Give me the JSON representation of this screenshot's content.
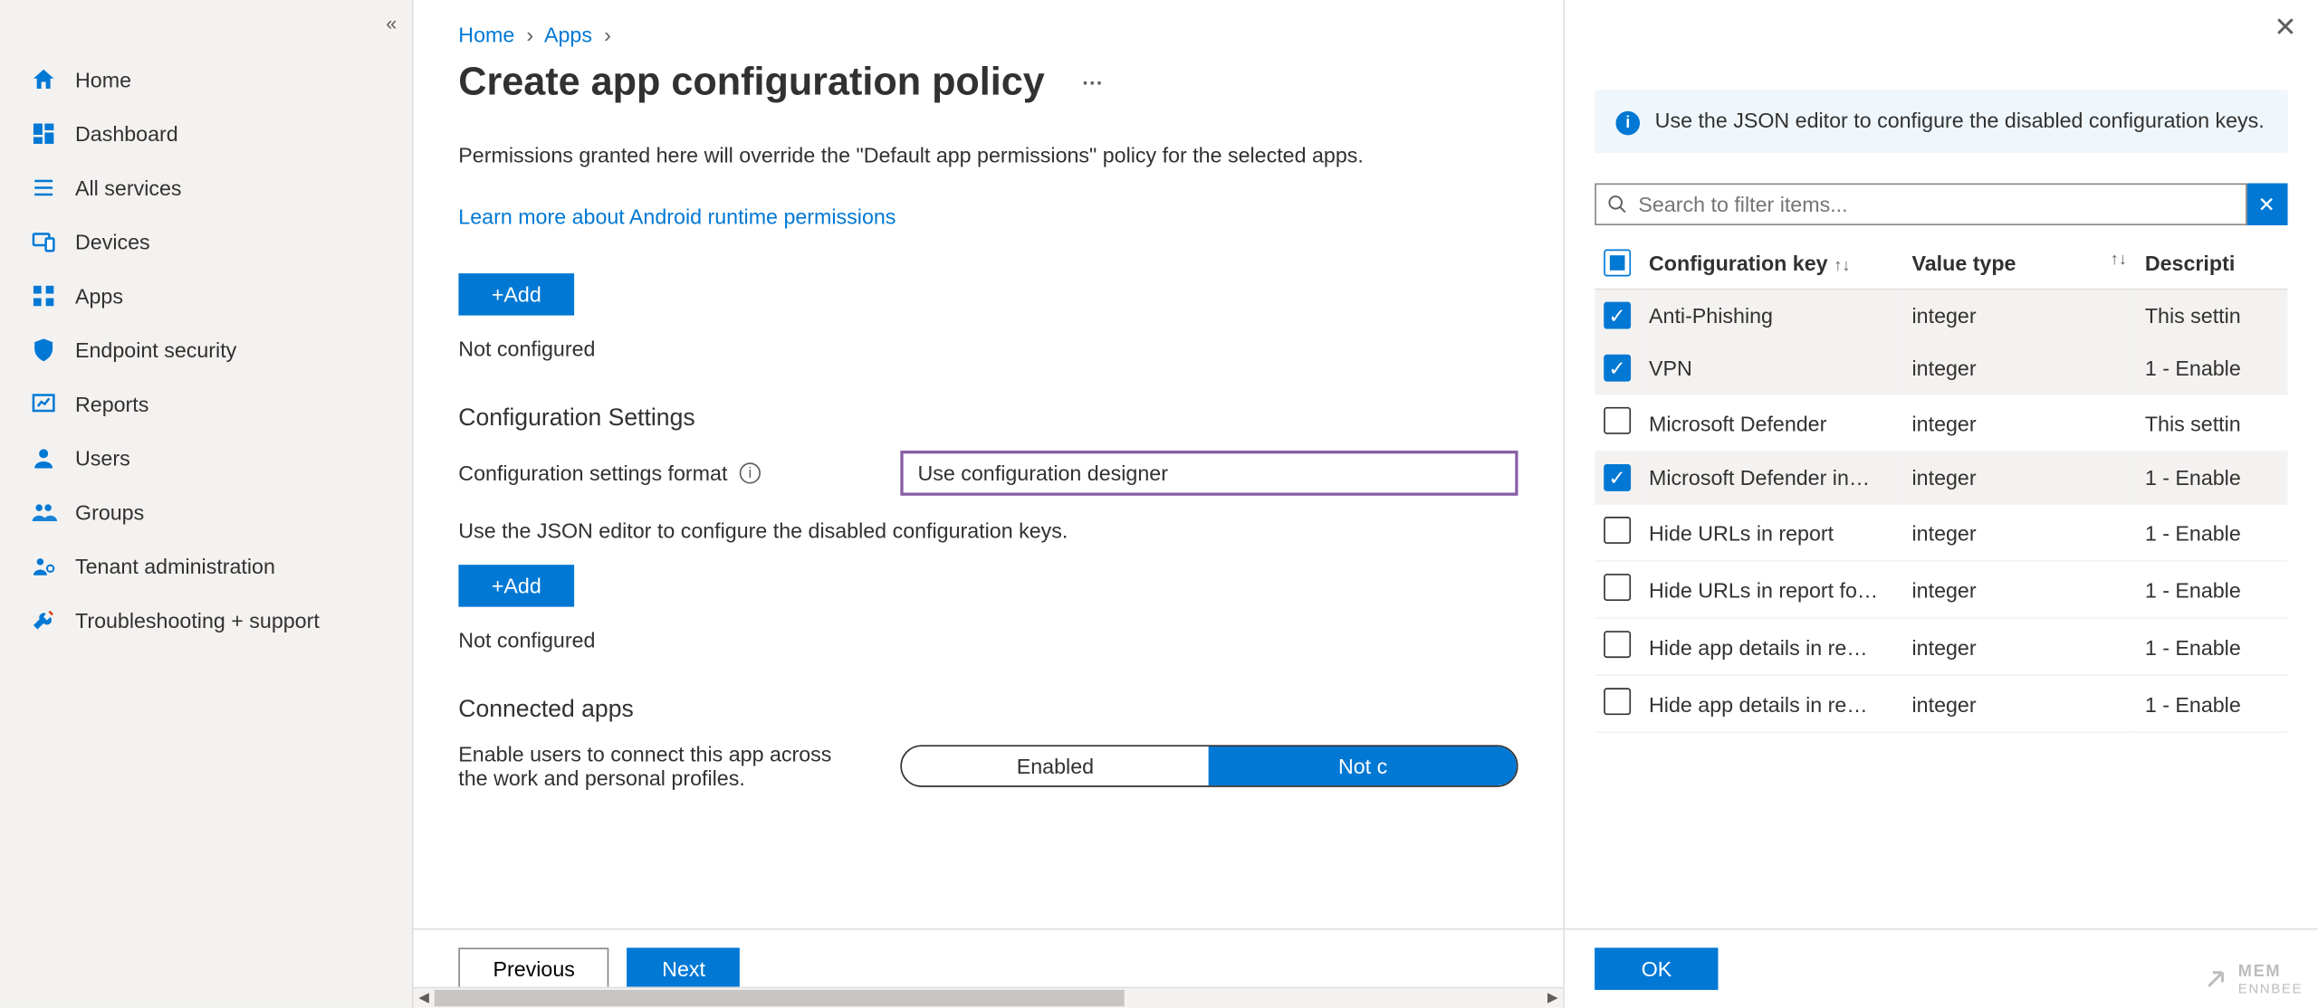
{
  "sidebar": {
    "items": [
      {
        "label": "Home",
        "icon": "home"
      },
      {
        "label": "Dashboard",
        "icon": "dashboard"
      },
      {
        "label": "All services",
        "icon": "list"
      },
      {
        "label": "Devices",
        "icon": "devices"
      },
      {
        "label": "Apps",
        "icon": "apps"
      },
      {
        "label": "Endpoint security",
        "icon": "shield"
      },
      {
        "label": "Reports",
        "icon": "reports"
      },
      {
        "label": "Users",
        "icon": "user"
      },
      {
        "label": "Groups",
        "icon": "group"
      },
      {
        "label": "Tenant administration",
        "icon": "tenant"
      },
      {
        "label": "Troubleshooting + support",
        "icon": "wrench"
      }
    ]
  },
  "breadcrumb": {
    "home": "Home",
    "apps": "Apps"
  },
  "page": {
    "title": "Create app configuration policy",
    "perm_text": "Permissions granted here will override the \"Default app permissions\" policy for the selected apps.",
    "learn_link": "Learn more about Android runtime permissions",
    "add_button": "+Add",
    "not_configured": "Not configured",
    "config_section": "Configuration Settings",
    "config_format_label": "Configuration settings format",
    "config_format_value": "Use configuration designer",
    "json_hint": "Use the JSON editor to configure the disabled configuration keys.",
    "connected_section": "Connected apps",
    "connected_desc": "Enable users to connect this app across the work and personal profiles.",
    "toggle": {
      "enabled": "Enabled",
      "notc": "Not c"
    },
    "prev": "Previous",
    "next": "Next"
  },
  "panel": {
    "banner": "Use the JSON editor to configure the disabled configuration keys.",
    "search_placeholder": "Search to filter items...",
    "col_key": "Configuration key",
    "col_vt": "Value type",
    "col_desc": "Descripti",
    "rows": [
      {
        "key": "Anti-Phishing",
        "vt": "integer",
        "desc": "This settin",
        "checked": true
      },
      {
        "key": "VPN",
        "vt": "integer",
        "desc": "1 - Enable",
        "checked": true
      },
      {
        "key": "Microsoft Defender",
        "vt": "integer",
        "desc": "This settin",
        "checked": false
      },
      {
        "key": "Microsoft Defender in…",
        "vt": "integer",
        "desc": "1 - Enable",
        "checked": true
      },
      {
        "key": "Hide URLs in report",
        "vt": "integer",
        "desc": "1 - Enable",
        "checked": false
      },
      {
        "key": "Hide URLs in report fo…",
        "vt": "integer",
        "desc": "1 - Enable",
        "checked": false
      },
      {
        "key": "Hide app details in re…",
        "vt": "integer",
        "desc": "1 - Enable",
        "checked": false
      },
      {
        "key": "Hide app details in re…",
        "vt": "integer",
        "desc": "1 - Enable",
        "checked": false
      }
    ],
    "ok": "OK"
  },
  "watermark": {
    "l1": "MEM",
    "l2": "ENNBEE"
  }
}
